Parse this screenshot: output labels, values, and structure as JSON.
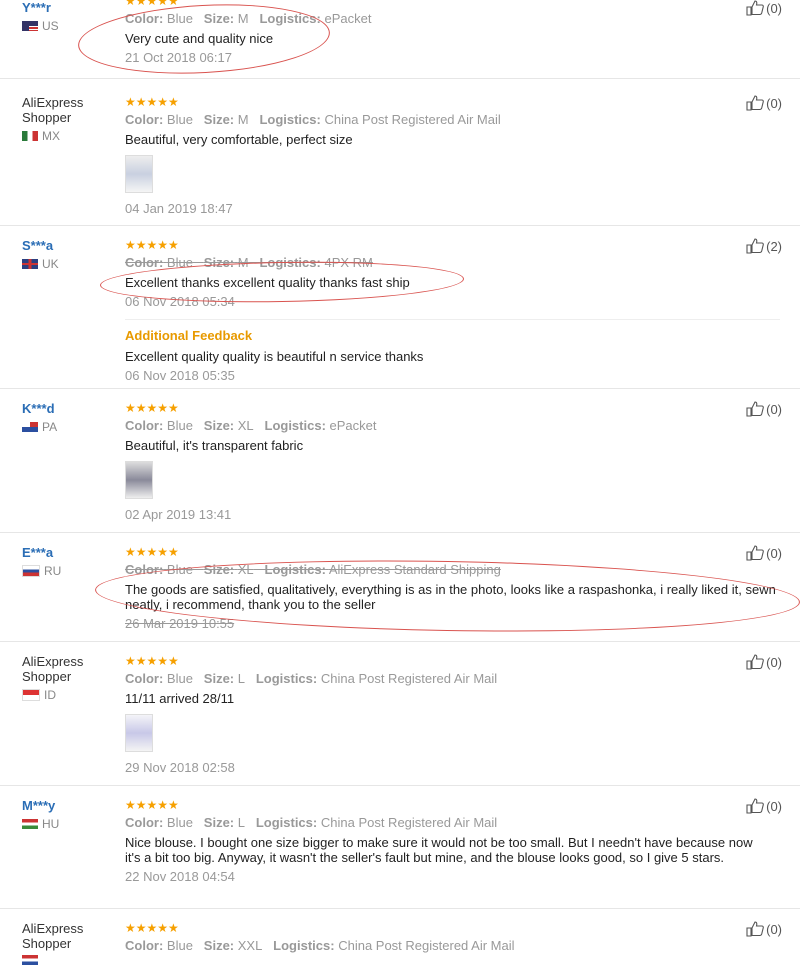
{
  "labels": {
    "color": "Color:",
    "size": "Size:",
    "logistics": "Logistics:",
    "additional_feedback": "Additional Feedback"
  },
  "stars": "★★★★★",
  "reviews": [
    {
      "user": "Y***r",
      "country": "US",
      "color": "Blue",
      "size": "M",
      "logistics": "ePacket",
      "text": "Very cute and quality nice",
      "date": "21 Oct 2018 06:17",
      "helpful": "(0)"
    },
    {
      "user": "AliExpress Shopper",
      "country": "MX",
      "color": "Blue",
      "size": "M",
      "logistics": "China Post Registered Air Mail",
      "text": "Beautiful, very comfortable, perfect size",
      "date": "04 Jan 2019 18:47",
      "helpful": "(0)"
    },
    {
      "user": "S***a",
      "country": "UK",
      "color": "Blue",
      "size": "M",
      "logistics": "4PX RM",
      "text": "Excellent thanks excellent quality thanks fast ship",
      "date": "06 Nov 2018 05:34",
      "helpful": "(2)",
      "additional_text": "Excellent quality quality is beautiful n service thanks",
      "additional_date": "06 Nov 2018 05:35"
    },
    {
      "user": "K***d",
      "country": "PA",
      "color": "Blue",
      "size": "XL",
      "logistics": "ePacket",
      "text": "Beautiful, it's transparent fabric",
      "date": "02 Apr 2019 13:41",
      "helpful": "(0)"
    },
    {
      "user": "E***a",
      "country": "RU",
      "color": "Blue",
      "size": "XL",
      "logistics": "AliExpress Standard Shipping",
      "text": "The goods are satisfied, qualitatively, everything is as in the photo, looks like a raspashonka, i really liked it, sewn neatly, i recommend, thank you to the seller",
      "date": "26 Mar 2019 10:55",
      "helpful": "(0)"
    },
    {
      "user": "AliExpress Shopper",
      "country": "ID",
      "color": "Blue",
      "size": "L",
      "logistics": "China Post Registered Air Mail",
      "text": "11/11 arrived 28/11",
      "date": "29 Nov 2018 02:58",
      "helpful": "(0)"
    },
    {
      "user": "M***y",
      "country": "HU",
      "color": "Blue",
      "size": "L",
      "logistics": "China Post Registered Air Mail",
      "text": "Nice blouse. I bought one size bigger to make sure it would not be too small. But I needn't have because now it's a bit too big. Anyway, it wasn't the seller's fault but mine, and the blouse looks good, so I give 5 stars.",
      "date": "22 Nov 2018 04:54",
      "helpful": "(0)"
    },
    {
      "user": "AliExpress Shopper",
      "country": "",
      "color": "Blue",
      "size": "XXL",
      "logistics": "China Post Registered Air Mail",
      "text": "",
      "date": "",
      "helpful": "(0)"
    }
  ]
}
